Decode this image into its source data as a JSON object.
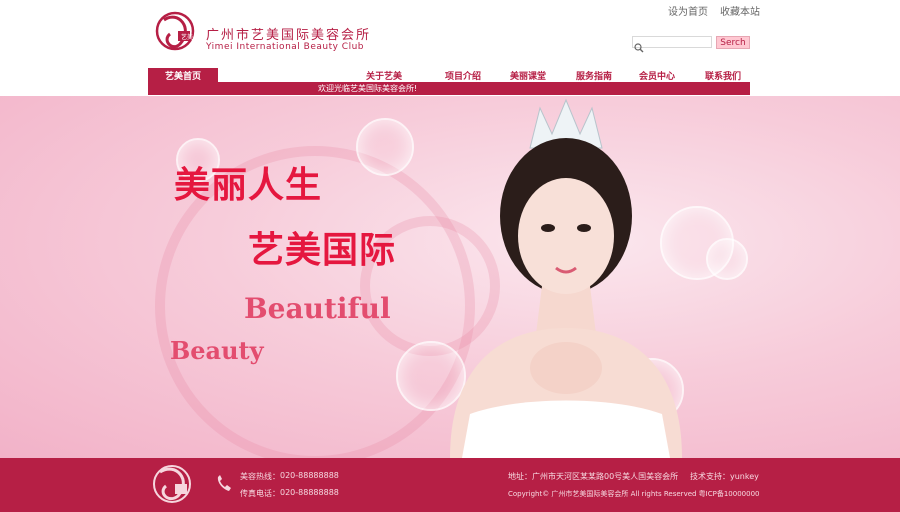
{
  "header": {
    "logo_text": "艺美",
    "brand_cn": "广州市艺美国际美容会所",
    "brand_en": "Yimei International Beauty Club",
    "links": [
      "设为首页",
      "收藏本站"
    ]
  },
  "search": {
    "placeholder": "",
    "button_label": "Serch"
  },
  "nav": {
    "items": [
      {
        "label": "艺美首页",
        "active": true
      },
      {
        "label": "关于艺美",
        "active": false
      },
      {
        "label": "项目介绍",
        "active": false
      },
      {
        "label": "美丽课堂",
        "active": false
      },
      {
        "label": "服务指南",
        "active": false
      },
      {
        "label": "会员中心",
        "active": false
      },
      {
        "label": "联系我们",
        "active": false
      }
    ]
  },
  "ticker": {
    "text": "欢迎光临艺美国际美容会所!"
  },
  "hero": {
    "cn_line_1": "美丽人生",
    "cn_line_2": "艺美国际",
    "en_line_1": "Beautiful",
    "en_line_2": "Beauty"
  },
  "footer": {
    "phone_label": "美容热线：",
    "phone_value": "020-88888888",
    "fax_label": "传真电话：",
    "fax_value": "020-88888888",
    "address": "地址：广州市天河区某某路00号美人国美容会所",
    "tech_support": "技术支持：yunkey",
    "copyright": "Copyright© 广州市艺美国际美容会所 All rights Reserved 粤ICP备10000000"
  },
  "colors": {
    "brand_red": "#b61f45",
    "hero_pink": "#f7ccda",
    "headline_red": "#e5173f"
  }
}
